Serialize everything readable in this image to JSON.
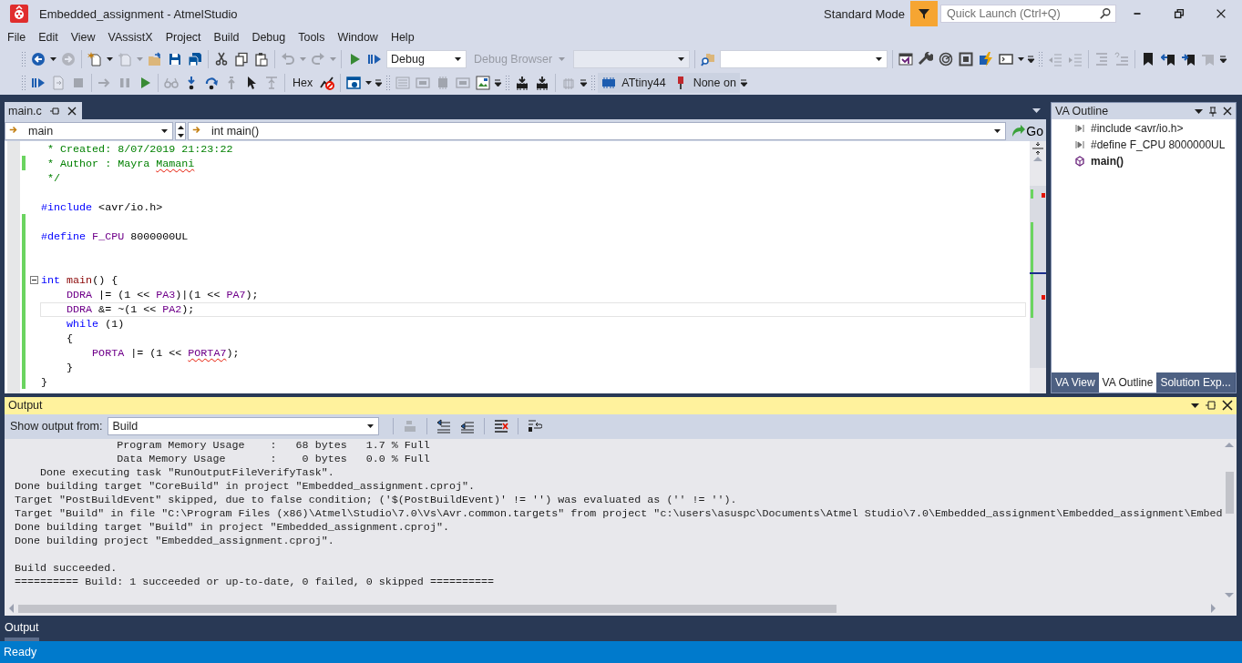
{
  "window": {
    "title": "Embedded_assignment - AtmelStudio",
    "mode": "Standard Mode",
    "quick_launch": {
      "placeholder": "Quick Launch (Ctrl+Q)"
    }
  },
  "menu": [
    "File",
    "Edit",
    "View",
    "VAssistX",
    "Project",
    "Build",
    "Debug",
    "Tools",
    "Window",
    "Help"
  ],
  "toolbar_rows": [
    {
      "items": [
        {
          "kind": "grip"
        },
        {
          "kind": "back",
          "disabled": false
        },
        {
          "kind": "caret",
          "disabled": false
        },
        {
          "kind": "forward",
          "disabled": true
        },
        {
          "kind": "separator"
        },
        {
          "kind": "new-project",
          "disabled": false
        },
        {
          "kind": "caret",
          "disabled": false
        },
        {
          "kind": "add-item",
          "disabled": true
        },
        {
          "kind": "caret",
          "disabled": true
        },
        {
          "kind": "open",
          "disabled": false
        },
        {
          "kind": "save",
          "disabled": false
        },
        {
          "kind": "save-all",
          "disabled": false
        },
        {
          "kind": "separator"
        },
        {
          "kind": "cut",
          "disabled": false
        },
        {
          "kind": "copy",
          "disabled": false
        },
        {
          "kind": "paste",
          "disabled": false
        },
        {
          "kind": "separator"
        },
        {
          "kind": "undo",
          "disabled": true
        },
        {
          "kind": "caret",
          "disabled": true
        },
        {
          "kind": "redo",
          "disabled": true
        },
        {
          "kind": "caret",
          "disabled": true
        },
        {
          "kind": "separator"
        },
        {
          "kind": "start",
          "disabled": false
        },
        {
          "kind": "continue",
          "disabled": false
        },
        {
          "kind": "config-combo",
          "label": "Debug",
          "disabled": false
        },
        {
          "kind": "menu-dropdown",
          "label": "Debug Browser",
          "disabled": true
        },
        {
          "kind": "platform-combo",
          "disabled": true
        },
        {
          "kind": "separator"
        },
        {
          "kind": "find-files",
          "disabled": false
        },
        {
          "kind": "find-combo",
          "disabled": false
        },
        {
          "kind": "separator"
        },
        {
          "kind": "vs-window",
          "disabled": false
        },
        {
          "kind": "wrench",
          "disabled": false
        },
        {
          "kind": "dial",
          "disabled": false
        },
        {
          "kind": "frame",
          "disabled": false
        },
        {
          "kind": "lightning",
          "disabled": false
        },
        {
          "kind": "terminal",
          "disabled": false
        },
        {
          "kind": "caret",
          "disabled": false
        },
        {
          "kind": "overflow",
          "disabled": false
        },
        {
          "kind": "grip"
        },
        {
          "kind": "outdent",
          "disabled": true
        },
        {
          "kind": "indent",
          "disabled": true
        },
        {
          "kind": "separator"
        },
        {
          "kind": "comment",
          "disabled": true
        },
        {
          "kind": "uncomment",
          "disabled": true
        },
        {
          "kind": "separator"
        },
        {
          "kind": "bookmark",
          "disabled": false
        },
        {
          "kind": "prev-bookmark",
          "disabled": false
        },
        {
          "kind": "next-bookmark",
          "disabled": false
        },
        {
          "kind": "clear-bookmark",
          "disabled": true
        },
        {
          "kind": "overflow",
          "disabled": false
        }
      ]
    },
    {
      "items": [
        {
          "kind": "grip"
        },
        {
          "kind": "continue",
          "disabled": false
        },
        {
          "kind": "file-arrow",
          "disabled": true
        },
        {
          "kind": "stop",
          "disabled": true
        },
        {
          "kind": "separator"
        },
        {
          "kind": "show-next",
          "disabled": true
        },
        {
          "kind": "pause",
          "disabled": true
        },
        {
          "kind": "start",
          "disabled": false
        },
        {
          "kind": "separator"
        },
        {
          "kind": "glasses",
          "disabled": true
        },
        {
          "kind": "step-into",
          "disabled": false
        },
        {
          "kind": "step-over",
          "disabled": false
        },
        {
          "kind": "step-out",
          "disabled": true
        },
        {
          "kind": "cursor",
          "disabled": false
        },
        {
          "kind": "run-to",
          "disabled": true
        },
        {
          "kind": "separator"
        },
        {
          "kind": "text-button",
          "label": "Hex",
          "disabled": false
        },
        {
          "kind": "chart-stop",
          "disabled": false
        },
        {
          "kind": "separator"
        },
        {
          "kind": "window",
          "disabled": false
        },
        {
          "kind": "caret",
          "disabled": false
        },
        {
          "kind": "overflow",
          "disabled": false
        },
        {
          "kind": "grip"
        },
        {
          "kind": "list",
          "disabled": true
        },
        {
          "kind": "panel",
          "disabled": true
        },
        {
          "kind": "chip",
          "disabled": true
        },
        {
          "kind": "panel",
          "disabled": true
        },
        {
          "kind": "image-window",
          "disabled": false
        },
        {
          "kind": "overflow",
          "disabled": false
        },
        {
          "kind": "grip"
        },
        {
          "kind": "chip-download",
          "disabled": false
        },
        {
          "kind": "chip-download",
          "disabled": false
        },
        {
          "kind": "separator"
        },
        {
          "kind": "chip-grid",
          "disabled": true
        },
        {
          "kind": "overflow",
          "disabled": false
        },
        {
          "kind": "grip"
        },
        {
          "kind": "device",
          "label": "ATtiny44",
          "disabled": false
        },
        {
          "kind": "tool",
          "label": "None on",
          "disabled": false
        },
        {
          "kind": "overflow",
          "disabled": false
        }
      ]
    }
  ],
  "editor": {
    "tabs": [
      {
        "label": "main.c",
        "selected": true
      }
    ],
    "nav": {
      "scope": "main",
      "member": "int main()",
      "go": "Go"
    },
    "lines": [
      {
        "changed": false,
        "current": false,
        "fold": false,
        "tokens": [
          {
            "kind": "comment",
            "text": " * Created: 8/07/2019 21:23:22",
            "squiggle": false
          }
        ]
      },
      {
        "changed": true,
        "current": false,
        "fold": false,
        "tokens": [
          {
            "kind": "comment",
            "text": " * Author : Mayra ",
            "squiggle": false
          },
          {
            "kind": "comment",
            "text": "Mamani",
            "squiggle": true
          }
        ]
      },
      {
        "changed": false,
        "current": false,
        "fold": false,
        "tokens": [
          {
            "kind": "comment",
            "text": " */",
            "squiggle": false
          }
        ]
      },
      {
        "changed": false,
        "current": false,
        "fold": false
      },
      {
        "changed": false,
        "current": false,
        "fold": false,
        "tokens": [
          {
            "kind": "keyword",
            "text": "#include",
            "squiggle": false
          },
          {
            "kind": "plain",
            "text": " <avr/io.h>",
            "squiggle": false
          }
        ]
      },
      {
        "changed": true,
        "current": false,
        "fold": false
      },
      {
        "changed": true,
        "current": false,
        "fold": false,
        "tokens": [
          {
            "kind": "keyword",
            "text": "#define",
            "squiggle": false
          },
          {
            "kind": "macro",
            "text": " F_CPU",
            "squiggle": false
          },
          {
            "kind": "plain",
            "text": " 8000000UL",
            "squiggle": false
          }
        ]
      },
      {
        "changed": true,
        "current": false,
        "fold": false
      },
      {
        "changed": true,
        "current": false,
        "fold": false
      },
      {
        "changed": true,
        "current": false,
        "fold": true,
        "tokens": [
          {
            "kind": "keyword",
            "text": "int",
            "squiggle": false
          },
          {
            "kind": "function",
            "text": " main",
            "squiggle": false
          },
          {
            "kind": "plain",
            "text": "() {",
            "squiggle": false
          }
        ]
      },
      {
        "changed": true,
        "current": false,
        "fold": false,
        "tokens": [
          {
            "kind": "macro",
            "text": "    DDRA",
            "squiggle": false
          },
          {
            "kind": "plain",
            "text": " |= (1 << ",
            "squiggle": false
          },
          {
            "kind": "macro",
            "text": "PA3",
            "squiggle": false
          },
          {
            "kind": "plain",
            "text": ")|(1 << ",
            "squiggle": false
          },
          {
            "kind": "macro",
            "text": "PA7",
            "squiggle": false
          },
          {
            "kind": "plain",
            "text": ");",
            "squiggle": false
          }
        ]
      },
      {
        "changed": true,
        "current": true,
        "fold": false,
        "tokens": [
          {
            "kind": "macro",
            "text": "    DDRA",
            "squiggle": false
          },
          {
            "kind": "plain",
            "text": " &= ~(1 << ",
            "squiggle": false
          },
          {
            "kind": "macro",
            "text": "PA2",
            "squiggle": false
          },
          {
            "kind": "plain",
            "text": ");",
            "squiggle": false
          }
        ]
      },
      {
        "changed": true,
        "current": false,
        "fold": false,
        "tokens": [
          {
            "kind": "keyword",
            "text": "    while",
            "squiggle": false
          },
          {
            "kind": "plain",
            "text": " (1)",
            "squiggle": false
          }
        ]
      },
      {
        "changed": true,
        "current": false,
        "fold": false,
        "tokens": [
          {
            "kind": "plain",
            "text": "    {",
            "squiggle": false
          }
        ]
      },
      {
        "changed": true,
        "current": false,
        "fold": false,
        "tokens": [
          {
            "kind": "macro",
            "text": "        PORTA",
            "squiggle": false
          },
          {
            "kind": "plain",
            "text": " |= (1 << ",
            "squiggle": false
          },
          {
            "kind": "macro",
            "text": "PORTA7",
            "squiggle": true
          },
          {
            "kind": "plain",
            "text": ");",
            "squiggle": false
          }
        ]
      },
      {
        "changed": true,
        "current": false,
        "fold": false,
        "tokens": [
          {
            "kind": "plain",
            "text": "    }",
            "squiggle": false
          }
        ]
      },
      {
        "changed": true,
        "current": false,
        "fold": false,
        "tokens": [
          {
            "kind": "plain",
            "text": "}",
            "squiggle": false
          }
        ]
      }
    ]
  },
  "va_outline": {
    "title": "VA Outline",
    "items": [
      {
        "kind": "directive",
        "text": "#include <avr/io.h>"
      },
      {
        "kind": "directive",
        "text": "#define F_CPU 8000000UL"
      },
      {
        "kind": "function",
        "text": "main()"
      }
    ],
    "tabs": [
      {
        "label": "VA View",
        "selected": false
      },
      {
        "label": "VA Outline",
        "selected": true
      },
      {
        "label": "Solution Exp...",
        "selected": false
      }
    ]
  },
  "output": {
    "title": "Output",
    "source_label": "Show output from:",
    "source": "Build",
    "lines": [
      "                Program Memory Usage    :   68 bytes   1.7 % Full",
      "                Data Memory Usage       :    0 bytes   0.0 % Full",
      "    Done executing task \"RunOutputFileVerifyTask\".",
      "Done building target \"CoreBuild\" in project \"Embedded_assignment.cproj\".",
      "Target \"PostBuildEvent\" skipped, due to false condition; ('$(PostBuildEvent)' != '') was evaluated as ('' != '').",
      "Target \"Build\" in file \"C:\\Program Files (x86)\\Atmel\\Studio\\7.0\\Vs\\Avr.common.targets\" from project \"c:\\users\\asuspc\\Documents\\Atmel Studio\\7.0\\Embedded_assignment\\Embedded_assignment\\Embed",
      "Done building target \"Build\" in project \"Embedded_assignment.cproj\".",
      "Done building project \"Embedded_assignment.cproj\".",
      "Build succeeded.",
      "========== Build: 1 succeeded or up-to-date, 0 failed, 0 skipped =========="
    ]
  },
  "bottom_tabs": [
    {
      "label": "Output",
      "selected": true
    }
  ],
  "status": "Ready"
}
